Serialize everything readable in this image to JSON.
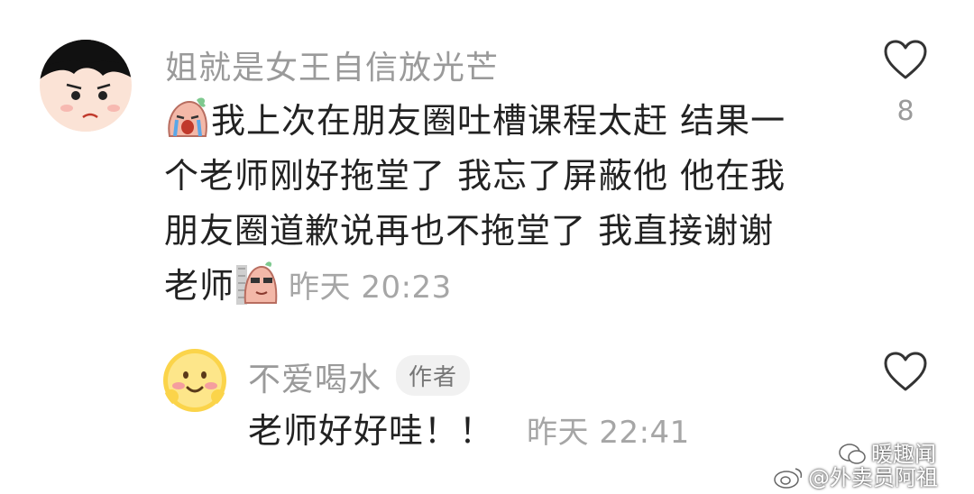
{
  "comment": {
    "username": "姐就是女王自信放光芒",
    "avatar_icon": "cartoon-girl-avatar",
    "lines": [
      "我上次在朋友圈吐槽课程太赶 结果一",
      "个老师刚好拖堂了 我忘了屏蔽他 他在我",
      "朋友圈道歉说再也不拖堂了 我直接谢谢",
      "老师"
    ],
    "time": "昨天 20:23",
    "like_count": "8"
  },
  "reply": {
    "username": "不爱喝水",
    "badge": "作者",
    "avatar_icon": "smiling-face-avatar",
    "text": "老师好好哇！！",
    "time": "昨天 22:41"
  },
  "watermark": {
    "brand": "暖趣闻",
    "handle": "@外卖员阿祖"
  }
}
